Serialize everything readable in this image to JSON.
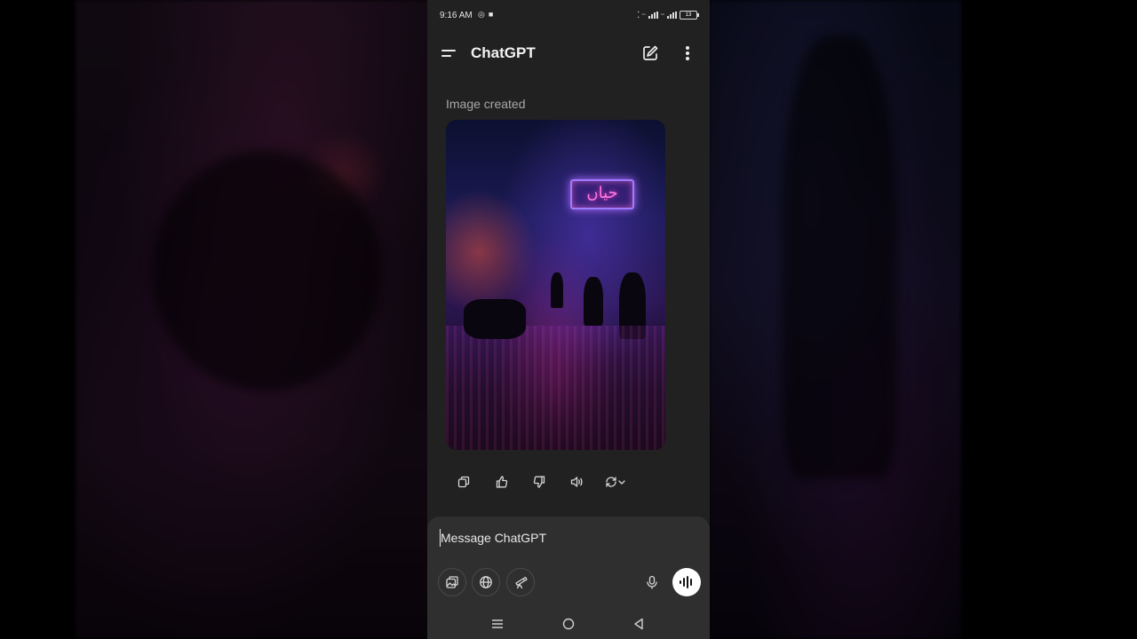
{
  "status_bar": {
    "time": "9:16 AM",
    "battery": "13"
  },
  "header": {
    "title": "ChatGPT"
  },
  "conversation": {
    "image_caption": "Image created",
    "image_sign_text": "حیاں"
  },
  "message_actions": [
    "copy-icon",
    "thumbs-up-icon",
    "thumbs-down-icon",
    "speaker-icon",
    "regenerate-icon"
  ],
  "composer": {
    "placeholder": "Message ChatGPT"
  },
  "icons": {
    "menu": "menu-icon",
    "edit": "new-chat-icon",
    "more": "more-vertical-icon",
    "attach": "attach-image-icon",
    "web": "globe-icon",
    "explore": "telescope-icon",
    "mic": "microphone-icon",
    "voice": "voice-mode-icon"
  },
  "colors": {
    "app_background": "#212121",
    "composer_background": "#2f2f2f",
    "text": "#ececec",
    "muted_text": "#a8a8a8"
  }
}
